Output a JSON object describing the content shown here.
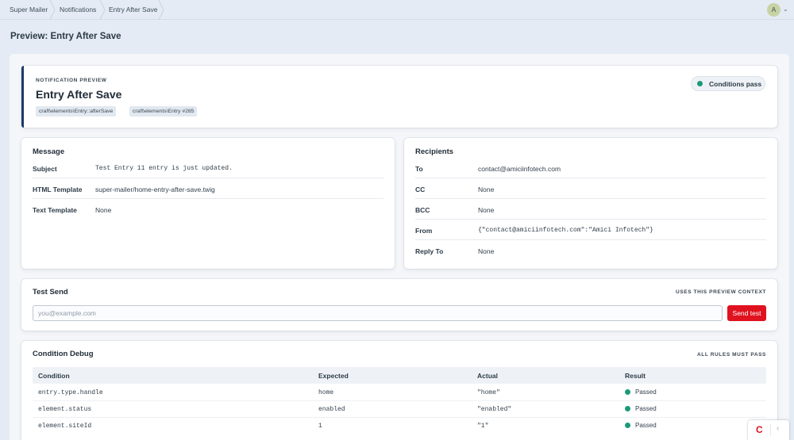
{
  "breadcrumb": [
    "Super Mailer",
    "Notifications",
    "Entry After Save"
  ],
  "user": {
    "avatar_initial": "A"
  },
  "page_title": "Preview: Entry After Save",
  "preview": {
    "eyebrow": "NOTIFICATION PREVIEW",
    "title": "Entry After Save",
    "chips": [
      "craft\\elements\\Entry::afterSave",
      "craft\\elements\\Entry #285"
    ],
    "status": "Conditions pass",
    "status_color": "#1a9a7a"
  },
  "message": {
    "heading": "Message",
    "rows": [
      {
        "label": "Subject",
        "value": "Test Entry 11 entry is just updated."
      },
      {
        "label": "HTML Template",
        "value": "super-mailer/home-entry-after-save.twig"
      },
      {
        "label": "Text Template",
        "value": "None"
      }
    ]
  },
  "recipients": {
    "heading": "Recipients",
    "rows": [
      {
        "label": "To",
        "value": "contact@amiciinfotech.com"
      },
      {
        "label": "CC",
        "value": "None"
      },
      {
        "label": "BCC",
        "value": "None"
      },
      {
        "label": "From",
        "value": "{\"contact@amiciinfotech.com\":\"Amici Infotech\"}"
      },
      {
        "label": "Reply To",
        "value": "None"
      }
    ]
  },
  "test_send": {
    "heading": "Test Send",
    "hint": "USES THIS PREVIEW CONTEXT",
    "placeholder": "you@example.com",
    "button": "Send test"
  },
  "condition_debug": {
    "heading": "Condition Debug",
    "hint": "ALL RULES MUST PASS",
    "columns": [
      "Condition",
      "Expected",
      "Actual",
      "Result"
    ],
    "rows": [
      {
        "condition": "entry.type.handle",
        "expected": "home",
        "actual": "\"home\"",
        "result": "Passed"
      },
      {
        "condition": "element.status",
        "expected": "enabled",
        "actual": "\"enabled\"",
        "result": "Passed"
      },
      {
        "condition": "element.siteId",
        "expected": "1",
        "actual": "\"1\"",
        "result": "Passed"
      }
    ],
    "pass_color": "#1a9a7a"
  },
  "corner_widget": {
    "logo": "C",
    "arrow": "‹"
  },
  "accent_color": "#e0121f"
}
